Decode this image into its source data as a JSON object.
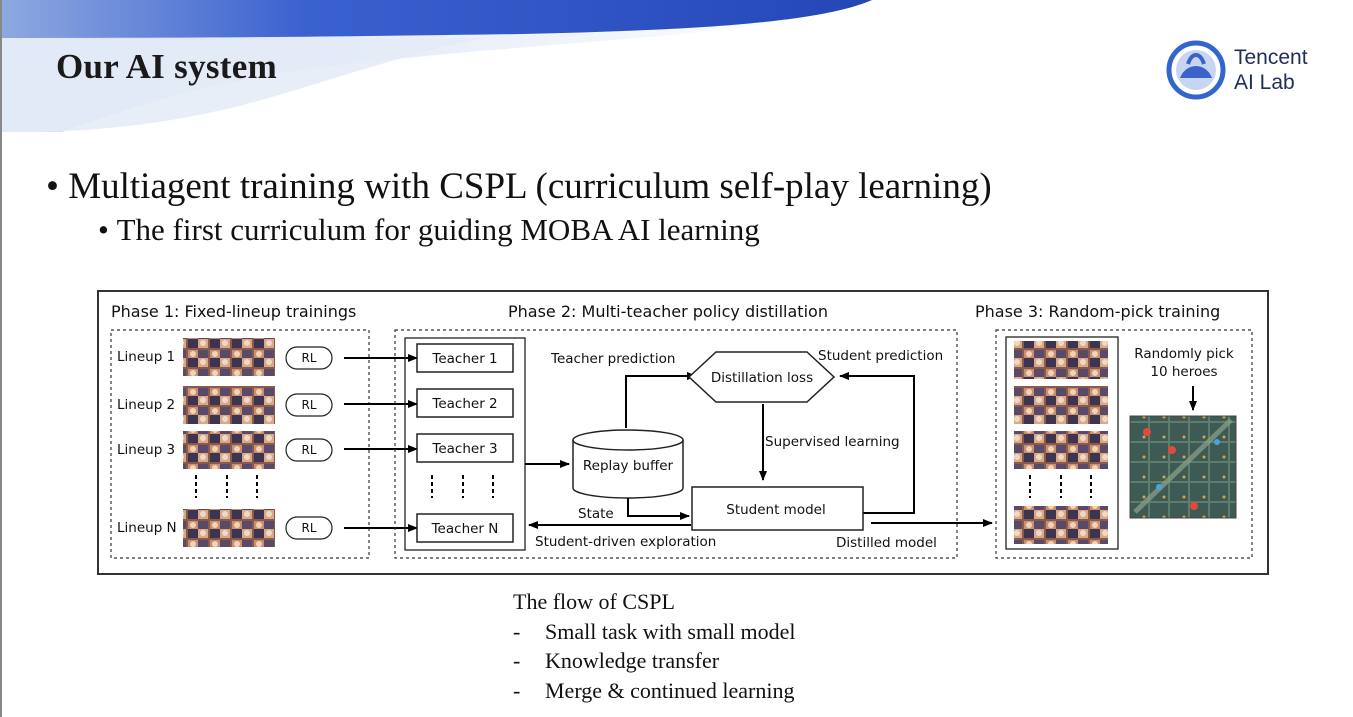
{
  "slide": {
    "title": "Our AI system",
    "bullets": [
      "Multiagent training with CSPL (curriculum self-play learning)",
      "The first curriculum for guiding MOBA AI learning"
    ]
  },
  "logo": {
    "line1": "Tencent",
    "line2": "AI Lab"
  },
  "figure": {
    "phase1": {
      "title": "Phase 1: Fixed-lineup trainings",
      "lineups": [
        "Lineup 1",
        "Lineup 2",
        "Lineup 3",
        "Lineup N"
      ],
      "rl_label": "RL"
    },
    "phase2": {
      "title": "Phase 2: Multi-teacher policy distillation",
      "teachers": [
        "Teacher 1",
        "Teacher 2",
        "Teacher 3",
        "Teacher N"
      ],
      "teacher_prediction": "Teacher prediction",
      "distillation_loss": "Distillation loss",
      "student_prediction": "Student prediction",
      "supervised_learning": "Supervised learning",
      "replay_buffer": "Replay buffer",
      "state": "State",
      "student_model": "Student model",
      "student_driven_exploration": "Student-driven exploration",
      "distilled_model": "Distilled model"
    },
    "phase3": {
      "title": "Phase 3: Random-pick training",
      "randomly_pick_line1": "Randomly pick",
      "randomly_pick_line2": "10 heroes"
    }
  },
  "caption": {
    "heading": "The flow of CSPL",
    "items": [
      "Small task with small model",
      "Knowledge transfer",
      "Merge & continued learning"
    ],
    "dash": "-"
  },
  "colors": {
    "banner_blue": "#2f56c8",
    "banner_light": "#dde6f6",
    "logo_blue": "#3366cc"
  }
}
